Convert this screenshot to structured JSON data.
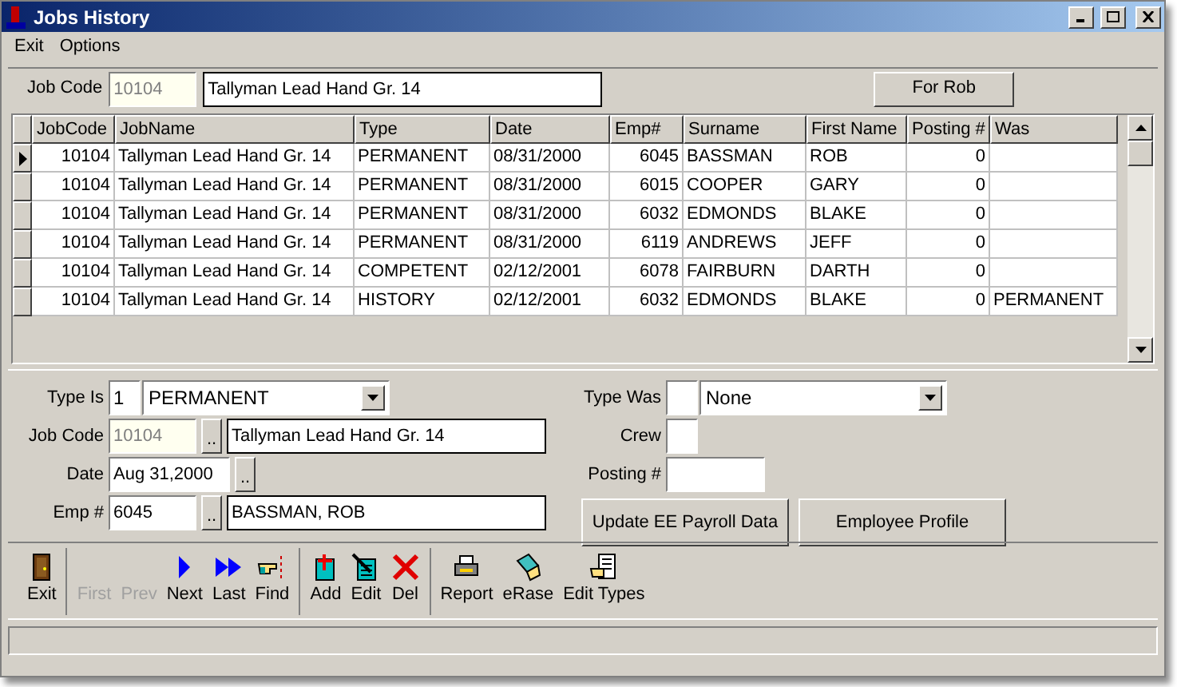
{
  "window": {
    "title": "Jobs History"
  },
  "menu": [
    "Exit",
    "Options"
  ],
  "header": {
    "label": "Job Code",
    "code": "10104",
    "name": "Tallyman Lead Hand Gr. 14",
    "button": "For Rob"
  },
  "table": {
    "columns": [
      "JobCode",
      "JobName",
      "Type",
      "Date",
      "Emp#",
      "Surname",
      "First Name",
      "Posting #",
      "Was"
    ],
    "rows": [
      {
        "selected": true,
        "cells": [
          "10104",
          "Tallyman Lead Hand Gr. 14",
          "PERMANENT",
          "08/31/2000",
          "6045",
          "BASSMAN",
          "ROB",
          "0",
          ""
        ]
      },
      {
        "selected": false,
        "cells": [
          "10104",
          "Tallyman Lead Hand Gr. 14",
          "PERMANENT",
          "08/31/2000",
          "6015",
          "COOPER",
          "GARY",
          "0",
          ""
        ]
      },
      {
        "selected": false,
        "cells": [
          "10104",
          "Tallyman Lead Hand Gr. 14",
          "PERMANENT",
          "08/31/2000",
          "6032",
          "EDMONDS",
          "BLAKE",
          "0",
          ""
        ]
      },
      {
        "selected": false,
        "cells": [
          "10104",
          "Tallyman Lead Hand Gr. 14",
          "PERMANENT",
          "08/31/2000",
          "6119",
          "ANDREWS",
          "JEFF",
          "0",
          ""
        ]
      },
      {
        "selected": false,
        "cells": [
          "10104",
          "Tallyman Lead Hand Gr. 14",
          "COMPETENT",
          "02/12/2001",
          "6078",
          "FAIRBURN",
          "DARTH",
          "0",
          ""
        ]
      },
      {
        "selected": false,
        "cells": [
          "10104",
          "Tallyman Lead Hand Gr. 14",
          "HISTORY",
          "02/12/2001",
          "6032",
          "EDMONDS",
          "BLAKE",
          "0",
          "PERMANENT"
        ]
      }
    ]
  },
  "form": {
    "type_is": {
      "label": "Type Is",
      "code": "1",
      "value": "PERMANENT"
    },
    "job_code": {
      "label": "Job Code",
      "code": "10104",
      "name": "Tallyman Lead Hand Gr. 14"
    },
    "date": {
      "label": "Date",
      "value": "Aug 31,2000"
    },
    "emp": {
      "label": "Emp #",
      "code": "6045",
      "name": "BASSMAN, ROB"
    },
    "type_was": {
      "label": "Type Was",
      "value": "None"
    },
    "crew": {
      "label": "Crew"
    },
    "posting": {
      "label": "Posting #"
    },
    "buttons": [
      "Update EE Payroll Data",
      "Employee Profile"
    ],
    "browse": ".."
  },
  "toolbar": {
    "groups": [
      [
        {
          "kind": "exit",
          "label": "Exit",
          "disabled": false
        }
      ],
      [
        {
          "label": "First",
          "disabled": true
        },
        {
          "label": "Prev",
          "disabled": true
        },
        {
          "kind": "next",
          "label": "Next",
          "disabled": false
        },
        {
          "kind": "last",
          "label": "Last",
          "disabled": false
        },
        {
          "kind": "find",
          "label": "Find",
          "disabled": false
        }
      ],
      [
        {
          "kind": "add",
          "label": "Add",
          "disabled": false
        },
        {
          "kind": "edit",
          "label": "Edit",
          "disabled": false
        },
        {
          "kind": "del",
          "label": "Del",
          "disabled": false
        }
      ],
      [
        {
          "kind": "report",
          "label": "Report",
          "disabled": false
        },
        {
          "kind": "erase",
          "label": "eRase",
          "disabled": false
        },
        {
          "kind": "types",
          "label": "Edit Types",
          "disabled": false
        }
      ]
    ]
  }
}
